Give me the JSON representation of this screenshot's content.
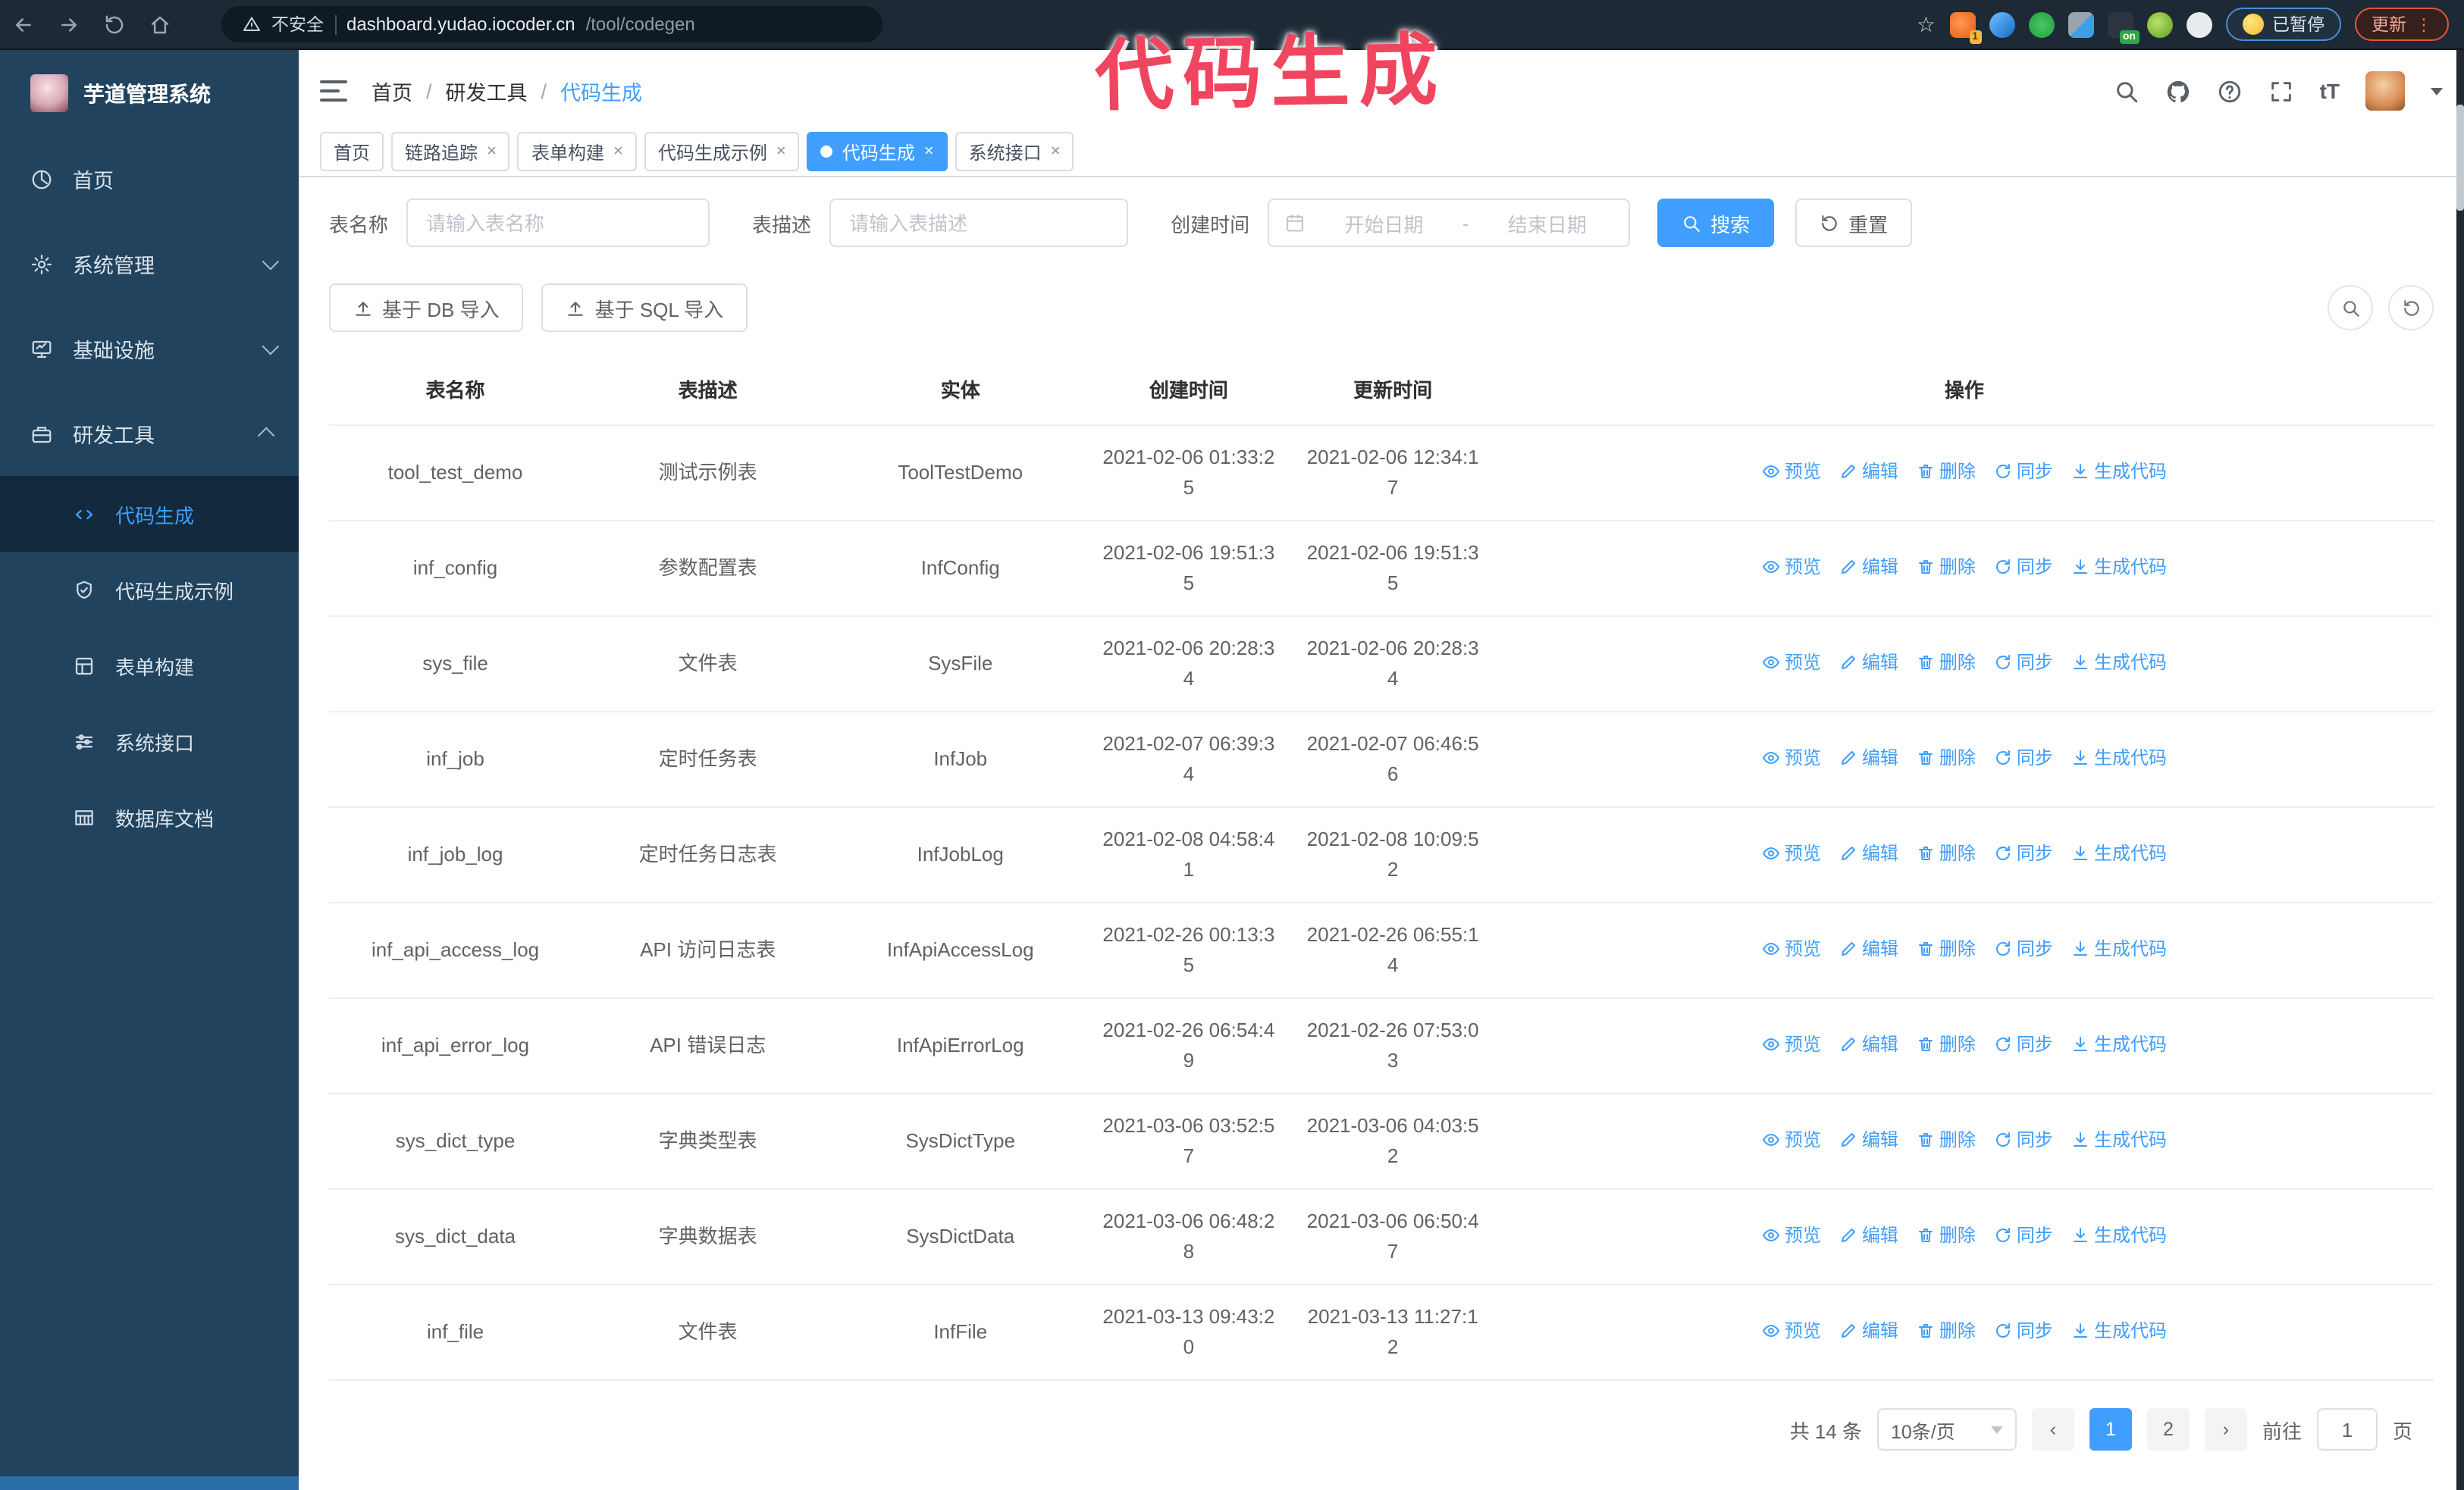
{
  "watermark": {
    "text": "代码生成",
    "color": "#f0455f"
  },
  "glyphs": {
    "slash": "/",
    "close": "×",
    "prev": "‹",
    "next": "›",
    "star": "☆",
    "dots": "⋮"
  },
  "browser": {
    "insecure_label": "不安全",
    "url_host": "dashboard.yudao.iocoder.cn",
    "url_path": "/tool/codegen",
    "extension_badge": "1",
    "extension_on_badge": "on",
    "paused_badge": "已暂停",
    "update_badge": "更新"
  },
  "sidebar": {
    "title": "芋道管理系统",
    "items": [
      {
        "label": "首页",
        "icon": "dashboard-icon"
      },
      {
        "label": "系统管理",
        "icon": "gear-icon"
      },
      {
        "label": "基础设施",
        "icon": "monitor-icon"
      },
      {
        "label": "研发工具",
        "icon": "toolbox-icon"
      }
    ],
    "subitems": [
      {
        "label": "代码生成",
        "icon": "code-icon",
        "active": true
      },
      {
        "label": "代码生成示例",
        "icon": "shield-check-icon"
      },
      {
        "label": "表单构建",
        "icon": "form-icon"
      },
      {
        "label": "系统接口",
        "icon": "sliders-icon"
      },
      {
        "label": "数据库文档",
        "icon": "database-icon"
      }
    ]
  },
  "header": {
    "breadcrumb": [
      {
        "label": "首页"
      },
      {
        "label": "研发工具"
      },
      {
        "label": "代码生成"
      }
    ],
    "font_size_icon_label": "tT"
  },
  "tabs": [
    {
      "label": "首页",
      "closable": false,
      "active": false
    },
    {
      "label": "链路追踪",
      "closable": true,
      "active": false
    },
    {
      "label": "表单构建",
      "closable": true,
      "active": false
    },
    {
      "label": "代码生成示例",
      "closable": true,
      "active": false
    },
    {
      "label": "代码生成",
      "closable": true,
      "active": true
    },
    {
      "label": "系统接口",
      "closable": true,
      "active": false
    }
  ],
  "filters": {
    "table_name_label": "表名称",
    "table_name_placeholder": "请输入表名称",
    "table_desc_label": "表描述",
    "table_desc_placeholder": "请输入表描述",
    "create_time_label": "创建时间",
    "date_start_placeholder": "开始日期",
    "date_separator": "-",
    "date_end_placeholder": "结束日期",
    "search_label": "搜索",
    "reset_label": "重置"
  },
  "toolbar": {
    "import_db_label": "基于 DB 导入",
    "import_sql_label": "基于 SQL 导入"
  },
  "table": {
    "columns": [
      "表名称",
      "表描述",
      "实体",
      "创建时间",
      "更新时间",
      "操作"
    ],
    "row_actions": [
      {
        "label": "预览",
        "name": "preview-link",
        "icon": "eye-icon"
      },
      {
        "label": "编辑",
        "name": "edit-link",
        "icon": "edit-icon"
      },
      {
        "label": "删除",
        "name": "delete-link",
        "icon": "trash-icon"
      },
      {
        "label": "同步",
        "name": "sync-link",
        "icon": "sync-icon"
      },
      {
        "label": "生成代码",
        "name": "generate-code-link",
        "icon": "download-icon"
      }
    ],
    "rows": [
      {
        "name": "tool_test_demo",
        "desc": "测试示例表",
        "entity": "ToolTestDemo",
        "created": "2021-02-06 01:33:25",
        "updated": "2021-02-06 12:34:17"
      },
      {
        "name": "inf_config",
        "desc": "参数配置表",
        "entity": "InfConfig",
        "created": "2021-02-06 19:51:35",
        "updated": "2021-02-06 19:51:35"
      },
      {
        "name": "sys_file",
        "desc": "文件表",
        "entity": "SysFile",
        "created": "2021-02-06 20:28:34",
        "updated": "2021-02-06 20:28:34"
      },
      {
        "name": "inf_job",
        "desc": "定时任务表",
        "entity": "InfJob",
        "created": "2021-02-07 06:39:34",
        "updated": "2021-02-07 06:46:56"
      },
      {
        "name": "inf_job_log",
        "desc": "定时任务日志表",
        "entity": "InfJobLog",
        "created": "2021-02-08 04:58:41",
        "updated": "2021-02-08 10:09:52"
      },
      {
        "name": "inf_api_access_log",
        "desc": "API 访问日志表",
        "entity": "InfApiAccessLog",
        "created": "2021-02-26 00:13:35",
        "updated": "2021-02-26 06:55:14"
      },
      {
        "name": "inf_api_error_log",
        "desc": "API 错误日志",
        "entity": "InfApiErrorLog",
        "created": "2021-02-26 06:54:49",
        "updated": "2021-02-26 07:53:03"
      },
      {
        "name": "sys_dict_type",
        "desc": "字典类型表",
        "entity": "SysDictType",
        "created": "2021-03-06 03:52:57",
        "updated": "2021-03-06 04:03:52"
      },
      {
        "name": "sys_dict_data",
        "desc": "字典数据表",
        "entity": "SysDictData",
        "created": "2021-03-06 06:48:28",
        "updated": "2021-03-06 06:50:47"
      },
      {
        "name": "inf_file",
        "desc": "文件表",
        "entity": "InfFile",
        "created": "2021-03-13 09:43:20",
        "updated": "2021-03-13 11:27:12"
      }
    ]
  },
  "pagination": {
    "total_label": "共 14 条",
    "page_size_label": "10条/页",
    "pages": [
      "1",
      "2"
    ],
    "active_page": "1",
    "goto_label": "前往",
    "goto_value": "1",
    "goto_suffix": "页"
  },
  "colors": {
    "primary": "#409eff",
    "sidebar_bg": "#21435e",
    "watermark": "#f0455f"
  }
}
